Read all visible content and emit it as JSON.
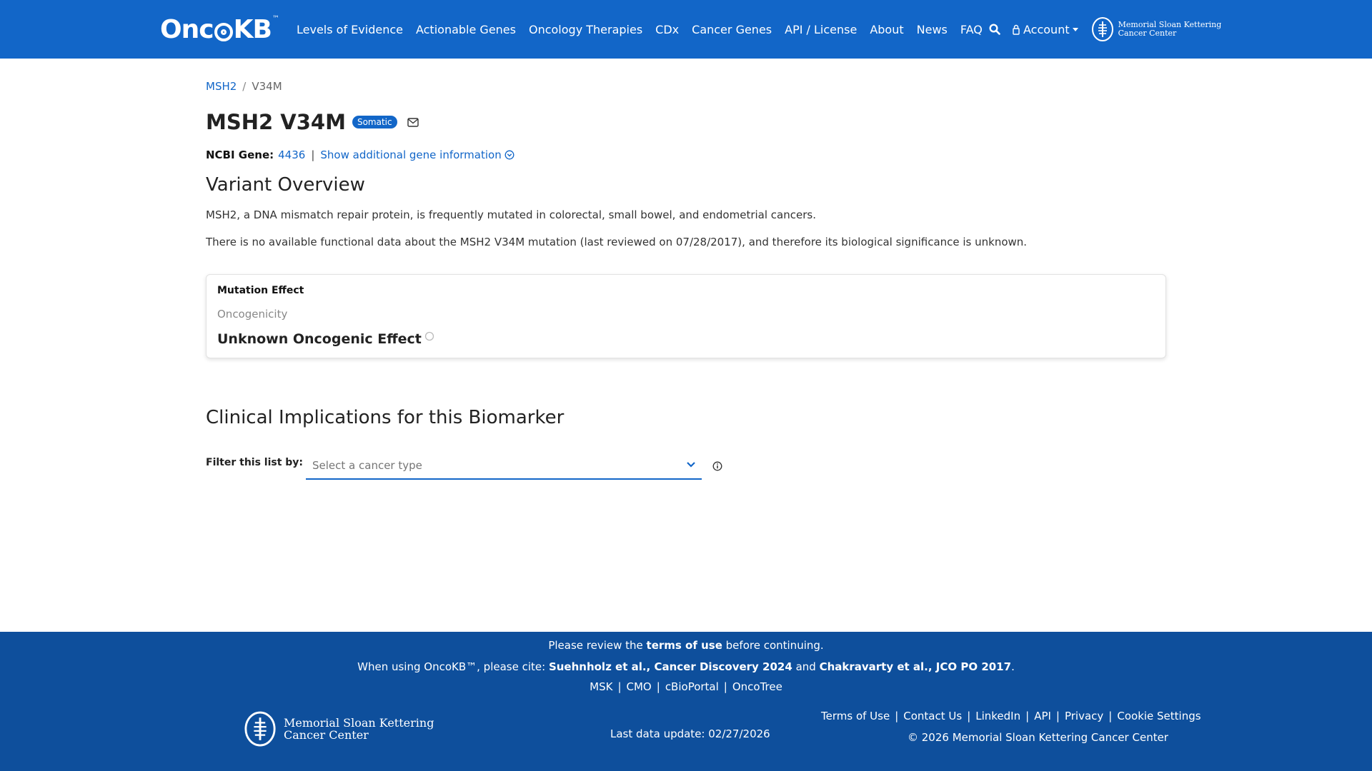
{
  "nav": {
    "logo_text": "OncoKB",
    "logo_tm": "™",
    "links": [
      "Levels of Evidence",
      "Actionable Genes",
      "Oncology Therapies",
      "CDx",
      "Cancer Genes",
      "API / License",
      "About",
      "News",
      "FAQ"
    ],
    "account_label": "Account",
    "msk_line1": "Memorial Sloan Kettering",
    "msk_line2": "Cancer Center"
  },
  "breadcrumb": {
    "gene": "MSH2",
    "separator": "/",
    "variant": "V34M"
  },
  "header": {
    "title": "MSH2 V34M",
    "badge": "Somatic",
    "ncbi_label": "NCBI Gene:",
    "ncbi_id": "4436",
    "separator": "|",
    "more_info": "Show additional gene information"
  },
  "overview": {
    "heading": "Variant Overview",
    "para1": "MSH2, a DNA mismatch repair protein, is frequently mutated in colorectal, small bowel, and endometrial cancers.",
    "para2": "There is no available functional data about the MSH2 V34M mutation (last reviewed on 07/28/2017), and therefore its biological significance is unknown."
  },
  "mutation_card": {
    "label": "Mutation Effect",
    "sub": "Oncogenicity",
    "value": "Unknown Oncogenic Effect"
  },
  "clinical": {
    "heading": "Clinical Implications for this Biomarker",
    "filter_label": "Filter this list by:",
    "select_placeholder": "Select a cancer type"
  },
  "footer": {
    "review_pre": "Please review the ",
    "review_link": "terms of use",
    "review_post": " before continuing.",
    "cite_pre": "When using OncoKB™, please cite: ",
    "cite_1": "Suehnholz et al., Cancer Discovery 2024",
    "cite_and": " and ",
    "cite_2": "Chakravarty et al., JCO PO 2017",
    "cite_end": ".",
    "links": [
      "MSK",
      "CMO",
      "cBioPortal",
      "OncoTree"
    ],
    "logo_line1": "Memorial Sloan Kettering",
    "logo_line2": "Cancer Center",
    "last_update": "Last data update: 02/27/2026",
    "right_links": [
      "Terms of Use",
      "Contact Us",
      "LinkedIn",
      "API",
      "Privacy",
      "Cookie Settings"
    ],
    "copyright": "© 2026 Memorial Sloan Kettering Cancer Center",
    "sep": "|"
  },
  "colors": {
    "primary": "#1266c8",
    "footer": "#0e4f9c"
  },
  "icons": [
    "search-icon",
    "user-icon",
    "msk-logo-icon",
    "mail-icon",
    "chevron-circle-down-icon",
    "circle-outline-icon",
    "chevron-down-icon",
    "info-circle-icon"
  ]
}
